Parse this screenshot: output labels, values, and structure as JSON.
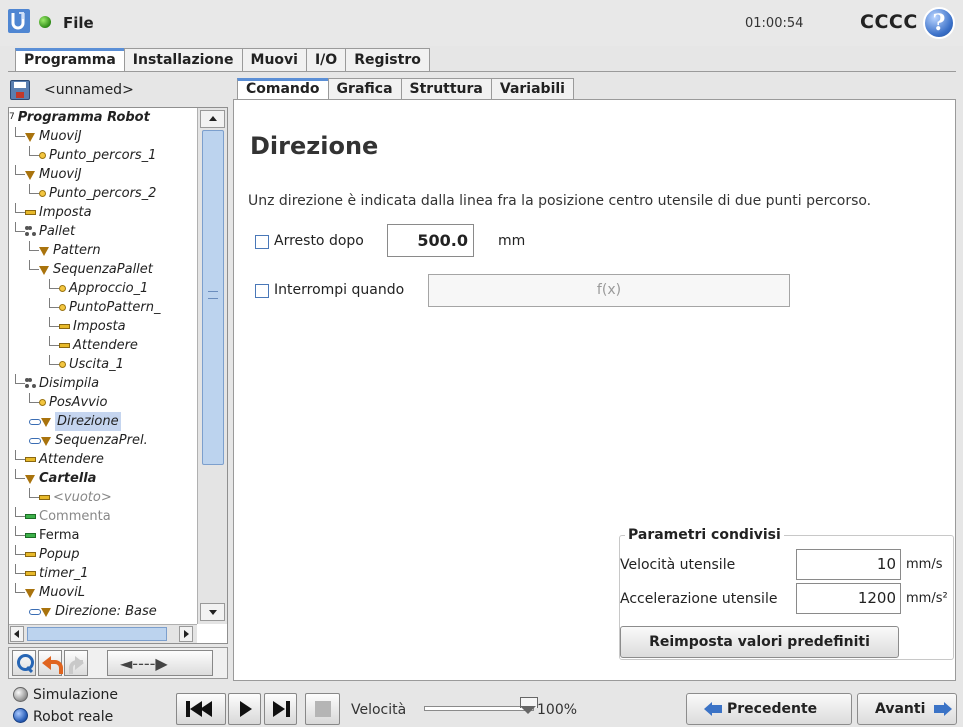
{
  "header": {
    "menu_label": "File",
    "clock": "01:00:54",
    "robot_name": "CCCC",
    "help_label": "?"
  },
  "main_tabs": [
    {
      "label": "Programma",
      "active": true
    },
    {
      "label": "Installazione",
      "active": false
    },
    {
      "label": "Muovi",
      "active": false
    },
    {
      "label": "I/O",
      "active": false
    },
    {
      "label": "Registro",
      "active": false
    }
  ],
  "left": {
    "program_name": "<unnamed>",
    "tree": [
      {
        "label": "Programma Robot",
        "icon": "none",
        "style": "bold"
      },
      {
        "label": "MuoviJ",
        "icon": "move-icon",
        "style": "italic"
      },
      {
        "label": "Punto_percors_1",
        "icon": "waypoint-icon",
        "style": "italic"
      },
      {
        "label": "MuoviJ",
        "icon": "move-icon",
        "style": "italic"
      },
      {
        "label": "Punto_percors_2",
        "icon": "waypoint-icon",
        "style": "italic"
      },
      {
        "label": "Imposta",
        "icon": "set-icon",
        "style": "italic"
      },
      {
        "label": "Pallet",
        "icon": "pallet-icon",
        "style": "italic"
      },
      {
        "label": "Pattern",
        "icon": "move-icon",
        "style": "italic"
      },
      {
        "label": "SequenzaPallet",
        "icon": "move-icon",
        "style": "italic"
      },
      {
        "label": "Approccio_1",
        "icon": "waypoint-icon",
        "style": "italic"
      },
      {
        "label": "PuntoPattern_",
        "icon": "waypoint-icon",
        "style": "italic"
      },
      {
        "label": "Imposta",
        "icon": "set-icon",
        "style": "italic"
      },
      {
        "label": "Attendere",
        "icon": "set-icon",
        "style": "italic"
      },
      {
        "label": "Uscita_1",
        "icon": "waypoint-icon",
        "style": "italic"
      },
      {
        "label": "Disimpila",
        "icon": "pallet-icon",
        "style": "italic"
      },
      {
        "label": "PosAvvio",
        "icon": "waypoint-icon",
        "style": "italic"
      },
      {
        "label": "Direzione",
        "icon": "move-icon",
        "style": "selected"
      },
      {
        "label": "SequenzaPrel.",
        "icon": "move-icon",
        "style": "italic"
      },
      {
        "label": "Attendere",
        "icon": "set-icon",
        "style": "italic"
      },
      {
        "label": "Cartella",
        "icon": "move-icon",
        "style": "bold"
      },
      {
        "label": "<vuoto>",
        "icon": "set-icon",
        "style": "gray-italic"
      },
      {
        "label": "Commenta",
        "icon": "comment-icon",
        "style": "gray"
      },
      {
        "label": "Ferma",
        "icon": "stop-icon",
        "style": "plain"
      },
      {
        "label": "Popup",
        "icon": "set-icon",
        "style": "italic"
      },
      {
        "label": "timer_1",
        "icon": "set-icon",
        "style": "italic"
      },
      {
        "label": "MuoviL",
        "icon": "move-icon",
        "style": "italic"
      },
      {
        "label": "Direzione: Base",
        "icon": "move-icon",
        "style": "italic"
      }
    ],
    "drag_label": "◄----▶"
  },
  "sub_tabs": [
    {
      "label": "Comando",
      "active": true
    },
    {
      "label": "Grafica",
      "active": false
    },
    {
      "label": "Struttura",
      "active": false
    },
    {
      "label": "Variabili",
      "active": false
    }
  ],
  "content": {
    "title": "Direzione",
    "description": "Unz direzione è indicata dalla linea fra la posizione centro utensile di due punti percorso.",
    "stop_after_label": "Arresto dopo",
    "stop_after_value": "500.0",
    "stop_after_unit": "mm",
    "stop_after_checked": false,
    "interrupt_label": "Interrompi quando",
    "interrupt_placeholder": "f(x)",
    "interrupt_checked": false
  },
  "shared_params": {
    "title": "Parametri condivisi",
    "tool_speed_label": "Velocità utensile",
    "tool_speed_value": "10",
    "tool_speed_unit": "mm/s",
    "tool_accel_label": "Accelerazione utensile",
    "tool_accel_value": "1200",
    "tool_accel_unit": "mm/s²",
    "reset_label": "Reimposta valori predefiniti"
  },
  "bottom": {
    "simulation_label": "Simulazione",
    "real_robot_label": "Robot reale",
    "selected_mode": "Robot reale",
    "speed_label": "Velocità",
    "speed_value": "100%",
    "speed_fraction": 1.0,
    "prev_label": "Precedente",
    "next_label": "Avanti"
  },
  "colors": {
    "accent_blue": "#5b8fd6",
    "selection": "#c5d5ef",
    "status_green": "#2e8b17"
  }
}
